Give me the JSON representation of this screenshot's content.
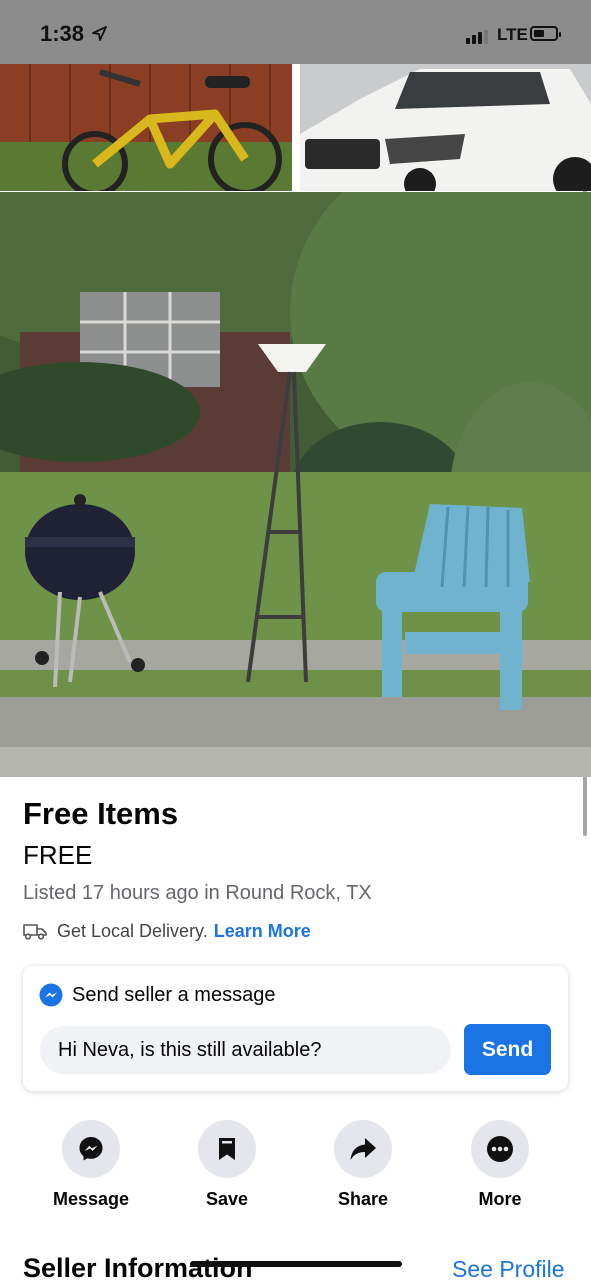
{
  "status_bar": {
    "time": "1:38",
    "carrier": "LTE",
    "battery_level": 0.35,
    "signal_bars": 3
  },
  "photos": {
    "thumbnails": [
      "bicycle-photo",
      "suv-photo"
    ],
    "main": "curbside-items-photo"
  },
  "listing": {
    "title": "Free Items",
    "price": "FREE",
    "listed_text": "Listed 17 hours ago in Round Rock, TX",
    "delivery_text": "Get Local Delivery.",
    "learn_more": "Learn More"
  },
  "message_card": {
    "heading": "Send seller a message",
    "input_value": "Hi Neva, is this still available?",
    "send_label": "Send"
  },
  "actions": [
    {
      "label": "Message",
      "icon": "messenger-icon"
    },
    {
      "label": "Save",
      "icon": "bookmark-icon"
    },
    {
      "label": "Share",
      "icon": "share-arrow-icon"
    },
    {
      "label": "More",
      "icon": "more-dots-icon"
    }
  ],
  "seller": {
    "heading": "Seller Information",
    "see_profile": "See Profile"
  },
  "colors": {
    "accent": "#1b74e4",
    "secondary_text": "#65676b",
    "button_bg": "#e4e6eb"
  }
}
